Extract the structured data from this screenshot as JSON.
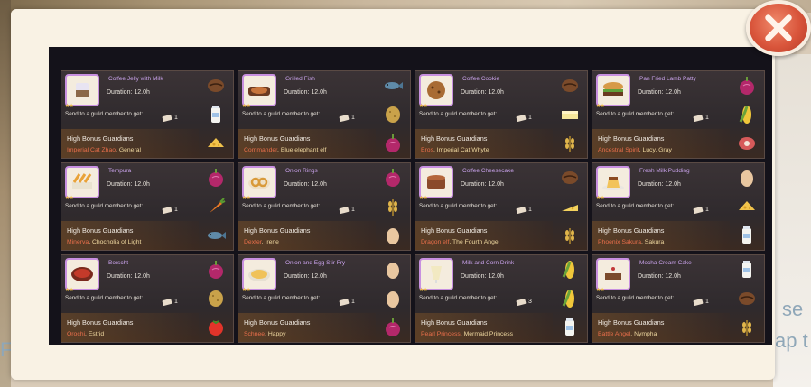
{
  "background": {
    "peek_a": "se",
    "peek_b": "ap t",
    "peek_c": "F"
  },
  "close_button": {
    "icon": "close-icon"
  },
  "cards": [
    {
      "name": "Coffee Jelly with Milk",
      "duration": "Duration: 12.0h",
      "send": "Send to a guild member to get:",
      "qty": "1",
      "guild": "High Bonus Guardians",
      "m1": "Imperial Cat Zhao",
      "m2": "General",
      "dish": "jelly",
      "ings": [
        "coffee-bean",
        "milk",
        "cheese"
      ]
    },
    {
      "name": "Grilled Fish",
      "duration": "Duration: 12.0h",
      "send": "Send to a guild member to get:",
      "qty": "1",
      "guild": "High Bonus Guardians",
      "m1": "Commander",
      "m2": "Blue elephant elf",
      "dish": "fish",
      "ings": [
        "fish",
        "potato",
        "onion"
      ]
    },
    {
      "name": "Coffee Cookie",
      "duration": "Duration: 12.0h",
      "send": "Send to a guild member to get:",
      "qty": "1",
      "guild": "High Bonus Guardians",
      "m1": "Eros",
      "m2": "Imperial Cat Whyte",
      "dish": "cookie",
      "ings": [
        "coffee-bean",
        "butter",
        "wheat"
      ]
    },
    {
      "name": "Pan Fried Lamb Patty",
      "duration": "Duration: 12.0h",
      "send": "Send to a guild member to get:",
      "qty": "1",
      "guild": "High Bonus Guardians",
      "m1": "Ancestral Spirit",
      "m2": "Lucy, Gray",
      "dish": "burger",
      "ings": [
        "onion",
        "corn",
        "meat"
      ]
    },
    {
      "name": "Tempura",
      "duration": "Duration: 12.0h",
      "send": "Send to a guild member to get:",
      "qty": "1",
      "guild": "High Bonus Guardians",
      "m1": "Minerva",
      "m2": "Chocholia of Light",
      "dish": "tempura",
      "ings": [
        "onion",
        "carrot",
        "fish"
      ]
    },
    {
      "name": "Onion Rings",
      "duration": "Duration: 12.0h",
      "send": "Send to a guild member to get:",
      "qty": "1",
      "guild": "High Bonus Guardians",
      "m1": "Dexter",
      "m2": "Irene",
      "dish": "rings",
      "ings": [
        "onion",
        "wheat",
        "egg"
      ]
    },
    {
      "name": "Coffee Cheesecake",
      "duration": "Duration: 12.0h",
      "send": "Send to a guild member to get:",
      "qty": "1",
      "guild": "High Bonus Guardians",
      "m1": "Dragon elf",
      "m2": "The Fourth Angel",
      "dish": "cake",
      "ings": [
        "coffee-bean",
        "cheese-wedge",
        "wheat"
      ]
    },
    {
      "name": "Fresh Milk Pudding",
      "duration": "Duration: 12.0h",
      "send": "Send to a guild member to get:",
      "qty": "1",
      "guild": "High Bonus Guardians",
      "m1": "Phoenix Sakura",
      "m2": "Sakura",
      "dish": "pudding",
      "ings": [
        "egg",
        "cheese",
        "milk"
      ]
    },
    {
      "name": "Borscht",
      "duration": "Duration: 12.0h",
      "send": "Send to a guild member to get:",
      "qty": "1",
      "guild": "High Bonus Guardians",
      "m1": "Orochi",
      "m2": "Estrid",
      "dish": "soup",
      "ings": [
        "onion",
        "potato",
        "tomato"
      ]
    },
    {
      "name": "Onion and Egg Stir Fry",
      "duration": "Duration: 12.0h",
      "send": "Send to a guild member to get:",
      "qty": "1",
      "guild": "High Bonus Guardians",
      "m1": "Schnee",
      "m2": "Happy",
      "dish": "stirfry",
      "ings": [
        "egg",
        "egg",
        "onion"
      ]
    },
    {
      "name": "Milk and Corn Drink",
      "duration": "Duration: 12.0h",
      "send": "Send to a guild member to get:",
      "qty": "3",
      "guild": "High Bonus Guardians",
      "m1": "Pearl Princess",
      "m2": "Mermaid Princess",
      "dish": "drink",
      "ings": [
        "corn",
        "corn",
        "milk"
      ]
    },
    {
      "name": "Mocha Cream Cake",
      "duration": "Duration: 12.0h",
      "send": "Send to a guild member to get:",
      "qty": "1",
      "guild": "High Bonus Guardians",
      "m1": "Battle Angel",
      "m2": "Nympha",
      "dish": "mocha",
      "ings": [
        "milk",
        "coffee-bean",
        "wheat"
      ]
    }
  ]
}
